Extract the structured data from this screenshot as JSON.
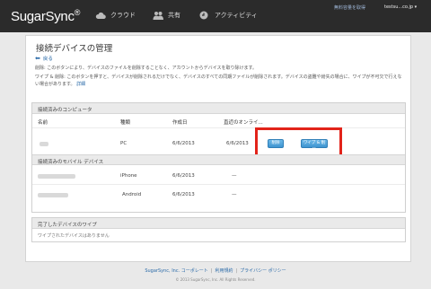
{
  "topbar": {
    "logo": "SugarSync",
    "logo_mark": "®",
    "nav": [
      {
        "label": "クラウド",
        "icon": "cloud-icon"
      },
      {
        "label": "共有",
        "icon": "people-icon"
      },
      {
        "label": "アクティビティ",
        "icon": "activity-icon"
      }
    ],
    "upgrade_link": "無料容量を取得",
    "account": "testsu...co.jp ▾"
  },
  "page": {
    "title": "接続デバイスの管理",
    "back": "戻る",
    "desc1": "削除: このボタンにより、デバイスのファイルを削除することなく、アカウントからデバイスを取り除けます。",
    "desc2": "ワイプ & 削除: このボタンを押すと、デバイスが削除されるだけでなく、デバイスのすべての同期ファイルが削除されます。デバイスの盗難や紛失の場合に、ワイプが不可欠で行えない場合があります。",
    "desc2_link": "詳細"
  },
  "computers": {
    "header": "接続済みのコンピュータ",
    "columns": {
      "name": "名前",
      "type": "種類",
      "date": "作成日",
      "online": "直近のオンライ..."
    },
    "rows": [
      {
        "type": "PC",
        "date": "6/6/2013",
        "online": "6/6/2013"
      }
    ],
    "buttons": {
      "delete": "削除",
      "wipe": "ワイプ & 削除"
    }
  },
  "mobile": {
    "header": "接続済みのモバイル デバイス",
    "rows": [
      {
        "type": "iPhone",
        "date": "6/6/2013",
        "online": "—"
      },
      {
        "type": "Android",
        "date": "6/6/2013",
        "online": "—"
      }
    ]
  },
  "wipe_section": {
    "header": "完了したデバイスのワイプ",
    "empty": "ワイプされたデバイスはありません"
  },
  "footer": {
    "links": [
      "SugarSync, Inc. コーポレート",
      "利用規約",
      "プライバシー ポリシー"
    ],
    "copyright": "© 2013 SugarSync, Inc. All Rights Reserved."
  },
  "colors": {
    "topbar": "#2b2b2b",
    "button": "#3e94cf",
    "highlight": "#e2231a",
    "link": "#2a6aa8"
  }
}
